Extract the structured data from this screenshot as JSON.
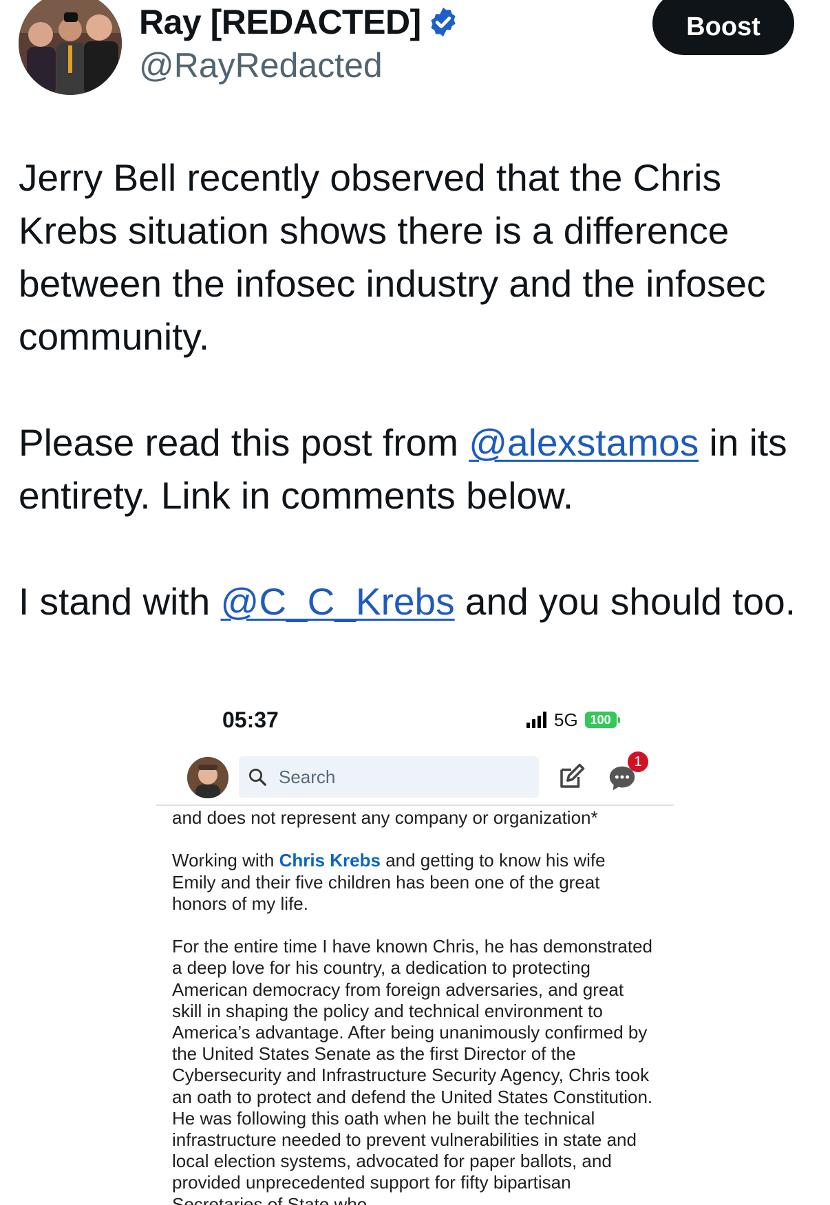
{
  "author": {
    "display_name": "Ray [REDACTED]",
    "handle": "@RayRedacted",
    "verified": true
  },
  "actions": {
    "boost_label": "Boost"
  },
  "post": {
    "p1": "Jerry Bell recently observed that the Chris Krebs situation shows there is a difference between the infosec industry and the infosec community.",
    "p2_before": "Please read this post from ",
    "p2_mention": "@alexstamos",
    "p2_after": " in its entirety. Link in comments below.",
    "p3_before": "I stand with ",
    "p3_mention": "@C_C_Krebs",
    "p3_after": " and you should too."
  },
  "embedded_screenshot": {
    "status_bar": {
      "time": "05:37",
      "network": "5G",
      "battery": "100"
    },
    "header": {
      "search_placeholder": "Search",
      "messages_badge": "1"
    },
    "article": {
      "line0": "and does not represent any company or organization*",
      "p1_before": "Working with ",
      "p1_link": "Chris Krebs",
      "p1_after": " and getting to know his wife Emily and their five children has been one of the great honors of my life.",
      "p2": "For the entire time I have known Chris, he has demonstrated a deep love for his country, a dedication to protecting American democracy from foreign adversaries, and great skill in shaping the policy and technical environment to America’s advantage. After being unanimously confirmed by the United States Senate as the first Director of the Cybersecurity and Infrastructure Security Agency, Chris took an oath to protect and defend the United States Constitution. He was following this oath when he built the technical infrastructure needed to prevent vulnerabilities in state and local election systems, advocated for paper ballots, and provided unprecedented support for fifty bipartisan Secretaries of State who"
    }
  },
  "colors": {
    "text": "#0f1419",
    "secondary": "#536471",
    "mention": "#1d5bbf",
    "verified_badge": "#1d60c9",
    "linkedin_link": "#0a66c2",
    "badge_red": "#d11124",
    "battery_green": "#34c759"
  }
}
